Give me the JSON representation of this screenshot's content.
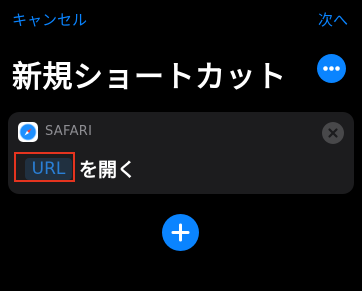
{
  "nav": {
    "cancel_label": "キャンセル",
    "next_label": "次へ"
  },
  "title": "新規ショートカット",
  "action": {
    "app_name": "SAFARI",
    "app_icon": "safari-compass-icon",
    "url_token": "URL",
    "verb": "を開く"
  },
  "icons": {
    "more": "ellipsis-circle-icon",
    "remove": "close-circle-icon",
    "add": "plus-circle-icon"
  },
  "colors": {
    "accent": "#0a84ff",
    "background": "#000000",
    "card": "#1c1c1e",
    "highlight": "#e5341f"
  }
}
